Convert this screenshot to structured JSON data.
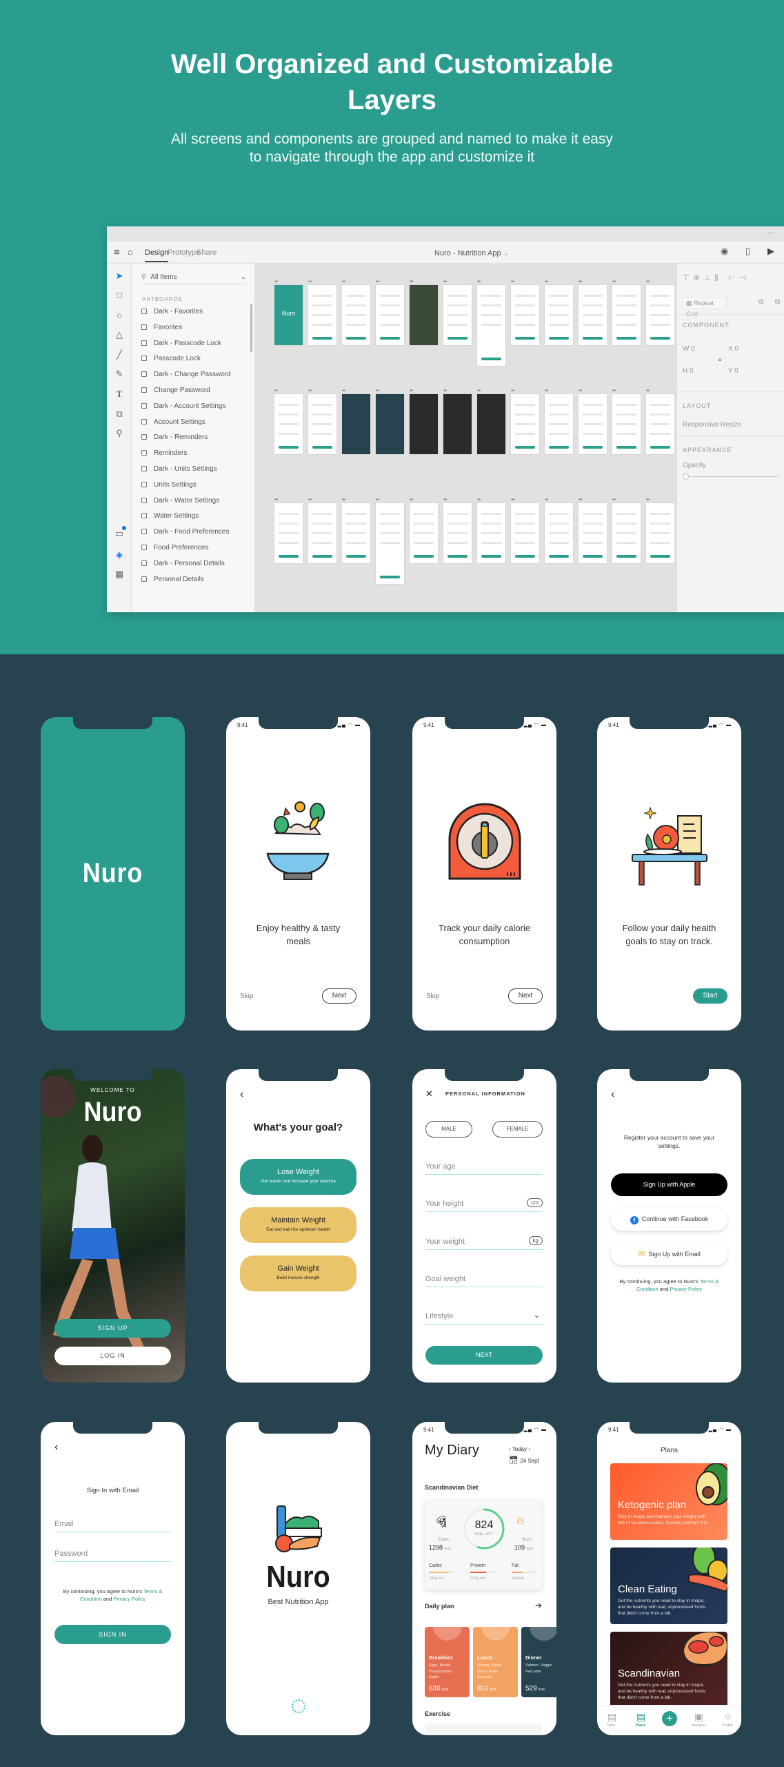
{
  "hero": {
    "title_line1": "Well Organized and Customizable",
    "title_line2": "Layers",
    "subtitle_line1": "All screens and components are grouped and named to make it easy",
    "subtitle_line2": "to navigate through the app and customize it"
  },
  "colors": {
    "teal": "#2a9d8f",
    "dark_bg": "#26434f",
    "yellow": "#e9c46a",
    "orange": "#ff6a3d",
    "navy": "#1e3250",
    "maroon": "#4a1f1f"
  },
  "editor": {
    "tabs": [
      "Design",
      "Prototype",
      "Share"
    ],
    "active_tab": "Design",
    "doc_title": "Nuro - Nutrition App",
    "search_placeholder": "All Items",
    "section_label": "ARTBOARDS",
    "layers": [
      "Dark - Favorites",
      "Favorites",
      "Dark - Passcode Lock",
      "Passcode Lock",
      "Dark - Change Password",
      "Change Password",
      "Dark - Account Settings",
      "Account Settings",
      "Dark - Reminders",
      "Reminders",
      "Dark - Units Settings",
      "Units Settings",
      "Dark - Water Settings",
      "Water Settings",
      "Dark - Food Preferences",
      "Food Preferences",
      "Dark - Personal Details",
      "Personal Details"
    ],
    "first_artboard_label": "Nuro",
    "artboard_rows": [
      [
        "#2a9d8f",
        "#ffffff",
        "#ffffff",
        "#ffffff",
        "#3b4a35",
        "#ffffff",
        "#ffffff",
        "#ffffff",
        "#ffffff",
        "#ffffff",
        "#ffffff",
        "#ffffff"
      ],
      [
        "#ffffff",
        "#ffffff",
        "#26434f",
        "#26434f",
        "#2a2a2a",
        "#2a2a2a",
        "#2a2a2a",
        "#ffffff",
        "#ffffff",
        "#ffffff",
        "#ffffff",
        "#ffffff"
      ],
      [
        "#ffffff",
        "#ffffff",
        "#ffffff",
        "#ffffff",
        "#ffffff",
        "#ffffff",
        "#ffffff",
        "#ffffff",
        "#ffffff",
        "#ffffff",
        "#ffffff",
        "#ffffff"
      ]
    ],
    "right_panel": {
      "repeat_grid": "Repeat Grid",
      "component": "COMPONENT",
      "w": "W",
      "w_val": "0",
      "x": "X",
      "x_val": "0",
      "h": "H",
      "h_val": "0",
      "y": "Y",
      "y_val": "0",
      "layout": "LAYOUT",
      "responsive": "Responsive Resize",
      "appearance": "APPEARANCE",
      "opacity": "Opacity"
    }
  },
  "status_time": "9:41",
  "splash": {
    "logo": "Nuro"
  },
  "onboarding": [
    {
      "text": "Enjoy healthy & tasty meals",
      "skip": "Skip",
      "action": "Next"
    },
    {
      "text": "Track your daily calorie consumption",
      "skip": "Skip",
      "action": "Next"
    },
    {
      "text": "Follow your daily health goals to stay on track.",
      "action": "Start"
    }
  ],
  "welcome": {
    "kicker": "WELCOME TO",
    "logo": "Nuro",
    "signup": "SIGN UP",
    "login": "LOG IN"
  },
  "goal": {
    "title": "What's your goal?",
    "options": [
      {
        "title": "Lose Weight",
        "desc": "Get leaner and increase your stamina"
      },
      {
        "title": "Maintain Weight",
        "desc": "Eat and train for optimum health"
      },
      {
        "title": "Gain Weight",
        "desc": "Build muscle strength"
      }
    ]
  },
  "personal": {
    "title": "PERSONAL INFORMATION",
    "male": "MALE",
    "female": "FEMALE",
    "age": "Your age",
    "height": "Your height",
    "height_unit": "cm",
    "weight": "Your weight",
    "weight_unit": "kg",
    "goal_weight": "Goal weight",
    "lifestyle": "Lifestyle",
    "next": "NEXT"
  },
  "register": {
    "text": "Register your account to save your settings.",
    "apple": "Sign Up with Apple",
    "facebook": "Continue with Facebook",
    "email": "Sign Up with Email",
    "terms_pre": "By continuing, you agree to Nuro's ",
    "terms_link": "Terms & Condition",
    "terms_and": " and ",
    "privacy_link": "Privacy Policy"
  },
  "signin": {
    "title": "Sign In with Email",
    "email": "Email",
    "password": "Password",
    "button": "SIGN IN"
  },
  "loading": {
    "logo": "Nuro",
    "tagline": "Best Nutrition App"
  },
  "diary": {
    "title": "My Diary",
    "day": "Today",
    "date": "24 Sept",
    "diet": "Scandinavian Diet",
    "kcal_left": "824",
    "kcal_left_label": "KCAL LEFT",
    "ring_progress": 0.55,
    "eaten_label": "Eaten",
    "eaten": "1298",
    "burn_label": "Burn",
    "burn": "109",
    "unit": "kcal",
    "macros": [
      {
        "name": "Carbs",
        "left": "186g left",
        "progress": 0.8,
        "color": "#e9c46a"
      },
      {
        "name": "Protein",
        "left": "323g left",
        "progress": 0.65,
        "color": "#f25c3c"
      },
      {
        "name": "Fat",
        "left": "82g left",
        "progress": 0.45,
        "color": "#f4a261"
      }
    ],
    "daily_plan": "Daily plan",
    "meals": [
      {
        "name": "Breakfast",
        "items": [
          "Eggs, Bread,",
          "Peanut butter,",
          "Apple"
        ],
        "kcal": "630",
        "color": "#e76f51"
      },
      {
        "name": "Lunch",
        "items": [
          "Quinoa, Salsa,",
          "Black beans,",
          "Avocado"
        ],
        "kcal": "812",
        "color": "#f4a261"
      },
      {
        "name": "Dinner",
        "items": [
          "Salmon, Veggie",
          "Red wine"
        ],
        "kcal": "529",
        "color": "#26434f"
      }
    ],
    "exercise": "Exercise"
  },
  "plans": {
    "title": "Plans",
    "cards": [
      {
        "title": "Ketogenic plan",
        "desc": "Stay in shape and maintain your weight with lots of fat and no carbs. Sounds yummy? It is"
      },
      {
        "title": "Clean Eating",
        "desc": "Get the nutrients you need to stay in shape, and be healthy with real, unprocessed foods that didn't come from a lab."
      },
      {
        "title": "Scandinavian",
        "desc": "Get the nutrients you need to stay in shape, and be healthy with real, unprocessed foods that didn't come from a lab."
      }
    ],
    "nav": [
      "Diary",
      "Plans",
      "Recipes",
      "Profile"
    ],
    "active_nav": "Plans"
  }
}
